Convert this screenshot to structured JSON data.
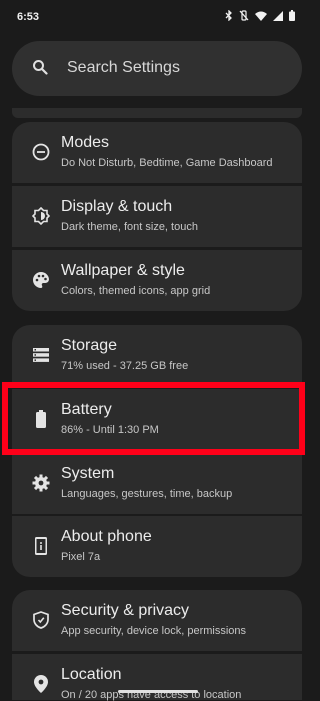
{
  "status": {
    "time": "6:53"
  },
  "search": {
    "placeholder": "Search Settings"
  },
  "groups": [
    {
      "items": [
        {
          "title": "Modes",
          "subtitle": "Do Not Disturb, Bedtime, Game Dashboard",
          "icon": "modes-icon"
        },
        {
          "title": "Display & touch",
          "subtitle": "Dark theme, font size, touch",
          "icon": "display-icon"
        },
        {
          "title": "Wallpaper & style",
          "subtitle": "Colors, themed icons, app grid",
          "icon": "palette-icon"
        }
      ]
    },
    {
      "items": [
        {
          "title": "Storage",
          "subtitle": "71% used - 37.25 GB free",
          "icon": "storage-icon"
        },
        {
          "title": "Battery",
          "subtitle": "86% - Until 1:30 PM",
          "icon": "battery-icon"
        },
        {
          "title": "System",
          "subtitle": "Languages, gestures, time, backup",
          "icon": "gear-icon"
        },
        {
          "title": "About phone",
          "subtitle": "Pixel 7a",
          "icon": "phone-info-icon"
        }
      ]
    },
    {
      "items": [
        {
          "title": "Security & privacy",
          "subtitle": "App security, device lock, permissions",
          "icon": "shield-icon"
        },
        {
          "title": "Location",
          "subtitle": "On / 20 apps have access to location",
          "icon": "location-icon"
        }
      ]
    }
  ],
  "highlight_color": "#ff0019"
}
